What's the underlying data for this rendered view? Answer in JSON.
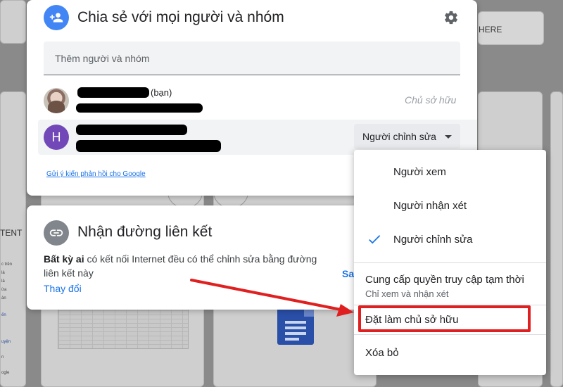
{
  "share_dialog": {
    "title": "Chia sẻ với mọi người và nhóm",
    "add_placeholder": "Thêm người và nhóm",
    "person1_suffix": "(bạn)",
    "person1_role": "Chủ sở hữu",
    "person2_initial": "H",
    "person2_role": "Người chỉnh sửa",
    "feedback_link": "Gửi ý kiến phản hồi cho Google"
  },
  "link_card": {
    "title": "Nhận đường liên kết",
    "desc_bold": "Bất kỳ ai",
    "desc_rest": " có kết nối Internet đều có thể chỉnh sửa bằng đường liên kết này",
    "change_label": "Thay đổi",
    "copy_partial": "Sa"
  },
  "role_menu": {
    "items": [
      {
        "label": "Người xem"
      },
      {
        "label": "Người nhận xét"
      },
      {
        "label": "Người chỉnh sửa",
        "checked": true
      }
    ],
    "temp_access": "Cung cấp quyền truy cập tạm thời",
    "temp_access_sub": "Chỉ xem và nhận xét",
    "make_owner": "Đặt làm chủ sở hữu",
    "remove": "Xóa bỏ"
  },
  "background": {
    "share_partial": "HERE",
    "content_partial": "TENT",
    "tiny_lines": [
      "c trên",
      "là",
      "là",
      "ừa",
      "àn",
      "ến",
      "uyện",
      "n",
      "ogle"
    ]
  },
  "colors": {
    "accent": "#1a73e8",
    "share_icon_bg": "#4285f4",
    "avatar_h_bg": "#7248b9",
    "highlight": "#e02020"
  },
  "icons": {
    "share": "person-add-icon",
    "settings": "gear-icon",
    "link": "link-icon",
    "check": "check-icon",
    "caret": "caret-down-icon"
  }
}
